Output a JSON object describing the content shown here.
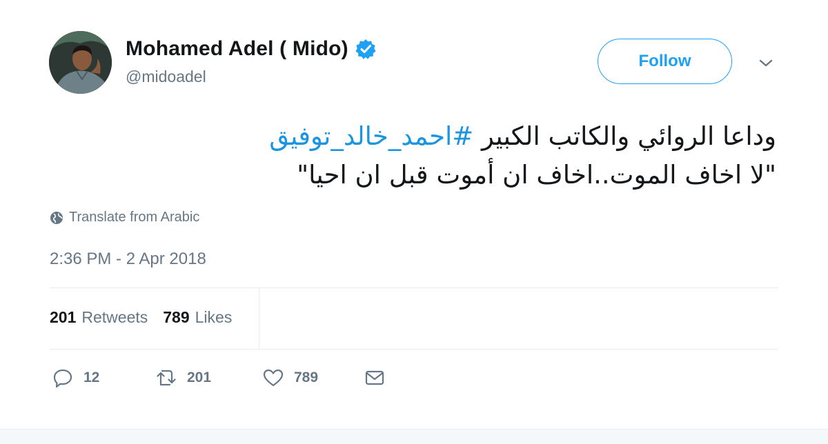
{
  "author": {
    "name": "Mohamed Adel ( Mido)",
    "handle": "@midoadel",
    "verified": true
  },
  "follow_button": {
    "label": "Follow"
  },
  "tweet": {
    "line1_text": "وداعا الروائي والكاتب الكبير ",
    "line1_hashtag": "#احمد_خالد_توفيق",
    "line2_text": "\"لا اخاف الموت..اخاف ان أموت قبل ان احيا\""
  },
  "translate": {
    "label": "Translate from Arabic",
    "icon": "globe-icon"
  },
  "timestamp": "2:36 PM - 2 Apr 2018",
  "stats": {
    "retweets_count": "201",
    "retweets_label": "Retweets",
    "likes_count": "789",
    "likes_label": "Likes"
  },
  "actions": {
    "reply_count": "12",
    "retweet_count": "201",
    "like_count": "789"
  },
  "colors": {
    "accent": "#1da1f2",
    "hashtag": "#1b95e0",
    "muted": "#657786",
    "text": "#14171a",
    "divider": "#e6ecf0"
  }
}
